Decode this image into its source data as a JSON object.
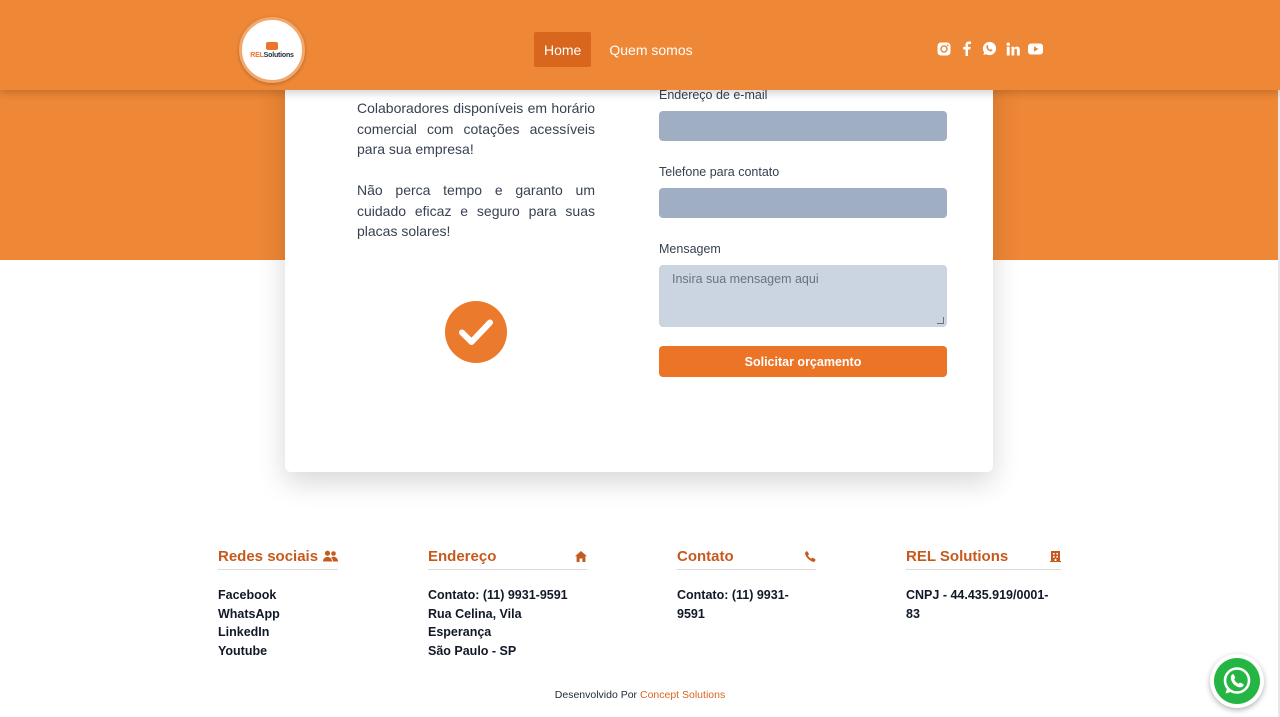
{
  "header": {
    "logo_text_a": "REL",
    "logo_text_b": "Solutions",
    "nav": [
      {
        "label": "Home",
        "active": true
      },
      {
        "label": "Quem somos",
        "active": false
      }
    ],
    "socials": [
      "instagram-icon",
      "facebook-icon",
      "whatsapp-icon",
      "linkedin-icon",
      "youtube-icon"
    ]
  },
  "card": {
    "paragraphs": [
      "Colaboradores disponíveis em horário comercial com cotações acessíveis para sua empresa!",
      "Não perca tempo e garanto um cuidado eficaz e seguro para suas placas solares!"
    ],
    "form": {
      "email_label": "Endereço de e-mail",
      "email_value": "",
      "phone_label": "Telefone para contato",
      "phone_value": "",
      "message_label": "Mensagem",
      "message_placeholder": "Insira sua mensagem aqui",
      "submit_label": "Solicitar orçamento"
    }
  },
  "footer": {
    "social": {
      "title": "Redes sociais",
      "icon": "users-icon",
      "items": [
        "Facebook",
        "WhatsApp",
        "LinkedIn",
        "Youtube"
      ]
    },
    "address": {
      "title": "Endereço",
      "icon": "home-icon",
      "items": [
        "Contato: (11) 9931-9591",
        "Rua Celina, Vila Esperança",
        "São Paulo - SP"
      ]
    },
    "contact": {
      "title": "Contato",
      "icon": "phone-icon",
      "items": [
        "Contato: (11) 9931-9591"
      ]
    },
    "company": {
      "title": "REL Solutions",
      "icon": "building-icon",
      "items": [
        "CNPJ - 44.435.919/0001-83"
      ]
    },
    "credits_prefix": "Desenvolvido Por",
    "credits_brand": "Concept Solutions"
  },
  "colors": {
    "brand": "#ee8736",
    "accent": "#ec7427",
    "heading": "#c65a1e",
    "input_fill": "#9faec2"
  }
}
